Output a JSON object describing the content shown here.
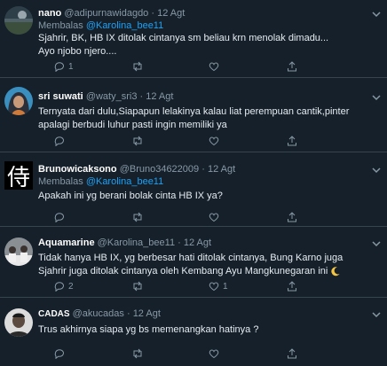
{
  "tweets": [
    {
      "name": "nano",
      "handle": "@adipurnawidagdo",
      "dot": "·",
      "time": "12 Agt",
      "reply_prefix": "Membalas",
      "reply_to": "@Karolina_bee11",
      "lines": [
        "Sjahrir, BK, HB IX ditolak cintanya sm beliau krn menolak dimadu...",
        "Ayo njobo njero...."
      ],
      "reply_count": "1",
      "like_count": "",
      "avatar_icon": "landscape-avatar"
    },
    {
      "name": "sri suwati",
      "handle": "@waty_sri3",
      "dot": "·",
      "time": "12 Agt",
      "lines": [
        "Ternyata dari dulu,Siapapun lelakinya kalau liat perempuan cantik,pinter",
        "apalagi berbudi luhur  pasti ingin memiliki ya"
      ],
      "reply_count": "",
      "like_count": "",
      "avatar_icon": "hijab-woman-avatar"
    },
    {
      "name": "Brunowicaksono",
      "handle": "@Bruno34622009",
      "dot": "·",
      "time": "12 Agt",
      "reply_prefix": "Membalas",
      "reply_to": "@Karolina_bee11",
      "lines": [
        "Apakah ini yg berani bolak cinta HB IX ya?"
      ],
      "reply_count": "",
      "like_count": "",
      "avatar_glyph": "侍",
      "avatar_icon": "kanji-samurai-avatar"
    },
    {
      "name": "Aquamarine",
      "handle": "@Karolina_bee11",
      "dot": "·",
      "time": "12 Agt",
      "lines": [
        "Tidak hanya HB IX, yg berbesar hati ditolak cintanya, Bung Karno juga",
        "Sjahrir juga ditolak cintanya oleh Kembang Ayu Mangkunegaran ini"
      ],
      "reply_count": "2",
      "like_count": "1",
      "avatar_icon": "group-photo-avatar",
      "emoji_icon": "crescent-moon-icon"
    },
    {
      "name": "CADAS",
      "handle": "@akucadas",
      "dot": "·",
      "time": "12 Agt",
      "lines": [
        "Trus akhirnya siapa yg bs memenangkan hatinya ?"
      ],
      "reply_count": "",
      "like_count": "",
      "avatar_icon": "man-portrait-avatar"
    }
  ],
  "colors": {
    "background": "#15202b",
    "divider": "#38444d",
    "secondary_text": "#8899a6",
    "mention": "#1da1f2"
  },
  "icons": {
    "reply": "reply-icon",
    "retweet": "retweet-icon",
    "like": "heart-icon",
    "share": "share-icon",
    "menu": "chevron-down-icon"
  }
}
